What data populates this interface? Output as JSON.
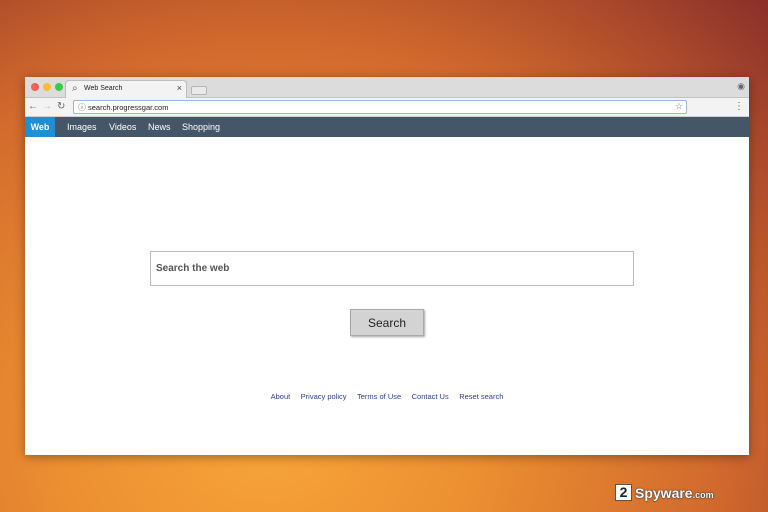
{
  "browser": {
    "tab": {
      "icon": "search-icon",
      "title": "Web Search",
      "close_label": "×"
    },
    "url": "search.progressgar.com",
    "icons": {
      "back": "arrow-left-icon",
      "forward": "arrow-right-icon",
      "reload": "reload-icon",
      "info": "info-icon",
      "bookmark": "star-icon",
      "menu": "kebab-menu-icon",
      "profile": "profile-icon"
    }
  },
  "nav": {
    "items": [
      {
        "label": "Web",
        "active": true
      },
      {
        "label": "Images"
      },
      {
        "label": "Videos"
      },
      {
        "label": "News"
      },
      {
        "label": "Shopping"
      }
    ],
    "background_color": "#455668",
    "active_color": "#1f8ed6"
  },
  "search": {
    "placeholder": "Search the web",
    "button_label": "Search"
  },
  "footer": {
    "links": [
      "About",
      "Privacy policy",
      "Terms of Use",
      "Contact Us",
      "Reset search"
    ]
  },
  "watermark": {
    "badge": "2",
    "brand": "Spyware",
    "domain": ".com"
  }
}
